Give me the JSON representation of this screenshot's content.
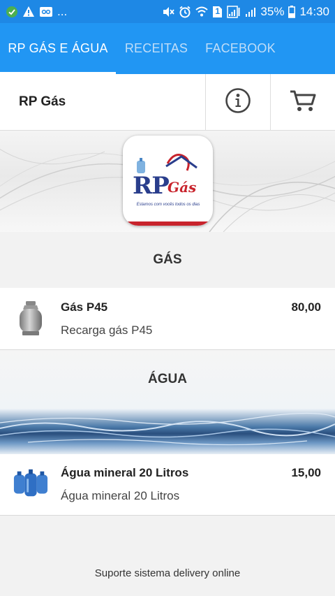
{
  "status_bar": {
    "battery": "35%",
    "time": "14:30",
    "sim": "1",
    "dots": "...",
    "notification_icons": [
      "check-circle-icon",
      "warning-icon",
      "voicemail-icon"
    ],
    "system_icons": [
      "mute-icon",
      "alarm-icon",
      "wifi-icon",
      "sim-icon",
      "signal-icon",
      "battery-icon"
    ]
  },
  "tabs": [
    {
      "label": "RP GÁS E ÁGUA",
      "active": true
    },
    {
      "label": "RECEITAS",
      "active": false
    },
    {
      "label": "FACEBOOK",
      "active": false
    }
  ],
  "header": {
    "title": "RP Gás",
    "info_icon": "info-icon",
    "cart_icon": "cart-icon"
  },
  "logo": {
    "rp": "RP",
    "gas": "Gás",
    "tagline": "Estamos com vocês todos os dias"
  },
  "sections": [
    {
      "title": "GÁS",
      "products": [
        {
          "name": "Gás P45",
          "description": "Recarga gás P45",
          "price": "80,00",
          "icon": "gas-cylinder-icon"
        }
      ]
    },
    {
      "title": "ÁGUA",
      "products": [
        {
          "name": "Água mineral 20 Litros",
          "description": "Água mineral 20 Litros",
          "price": "15,00",
          "icon": "water-jugs-icon"
        }
      ]
    }
  ],
  "footer": {
    "text": "Suporte sistema delivery online"
  },
  "colors": {
    "primary": "#2196F3",
    "status_bar": "#1E88E5",
    "tab_inactive": "#BFDDF8",
    "logo_blue": "#2A3E8C",
    "logo_red": "#C8232C"
  }
}
